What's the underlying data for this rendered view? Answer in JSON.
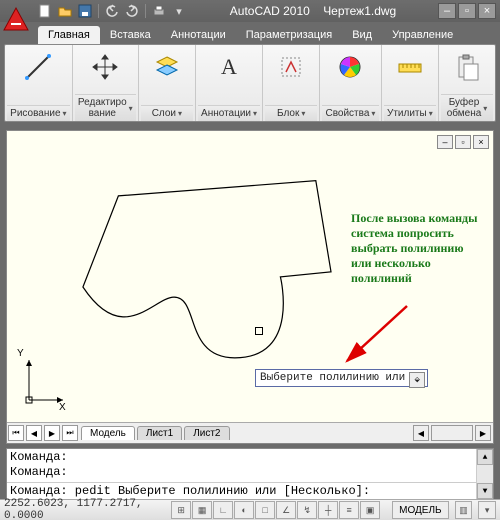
{
  "title": {
    "app": "AutoCAD 2010",
    "file": "Чертеж1.dwg"
  },
  "qat": {
    "new": "new",
    "open": "open",
    "save": "save",
    "undo": "undo",
    "redo": "redo",
    "print": "print",
    "menu": "▾"
  },
  "tabs": [
    {
      "label": "Главная",
      "active": true
    },
    {
      "label": "Вставка"
    },
    {
      "label": "Аннотации"
    },
    {
      "label": "Параметризация"
    },
    {
      "label": "Вид"
    },
    {
      "label": "Управление"
    }
  ],
  "panels": {
    "draw": "Рисование",
    "edit": "Редактиро\nвание",
    "layers": "Слои",
    "annot": "Аннотации",
    "block": "Блок",
    "props": "Свойства",
    "utils": "Утилиты",
    "clip": "Буфер\nобмена"
  },
  "model_tabs": {
    "model": "Модель",
    "sheet1": "Лист1",
    "sheet2": "Лист2"
  },
  "prompt_text": "Выберите полилинию или",
  "annotation": "После вызова команды система попросить выбрать полилинию или несколько полилиний",
  "cmd": {
    "hist1": "Команда:",
    "hist2": "Команда:",
    "current": "Команда:  pedit Выберите полилинию или [Несколько]:"
  },
  "status": {
    "coords": "2252.6023, 1177.2717, 0.0000",
    "model": "МОДЕЛЬ"
  },
  "axis": {
    "y": "Y",
    "x": "X"
  }
}
